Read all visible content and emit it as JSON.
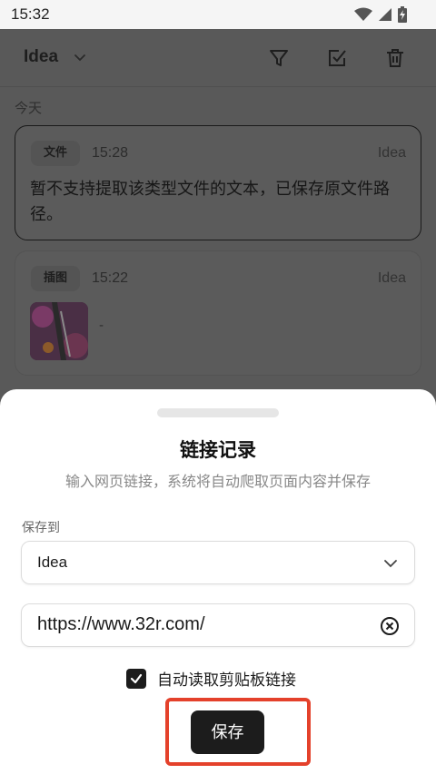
{
  "status_bar": {
    "time": "15:32",
    "icons": [
      "wifi-icon",
      "signal-icon",
      "battery-charging-icon"
    ]
  },
  "app_bar": {
    "title": "Idea",
    "actions": [
      "filter-icon",
      "select-check-icon",
      "delete-icon"
    ]
  },
  "section": {
    "label": "今天"
  },
  "cards": [
    {
      "tag": "文件",
      "time": "15:28",
      "source": "Idea",
      "body": "暂不支持提取该类型文件的文本，已保存原文件路径。"
    },
    {
      "tag": "插图",
      "time": "15:22",
      "source": "Idea",
      "body": "-"
    }
  ],
  "sheet": {
    "title": "链接记录",
    "subtitle": "输入网页链接，系统将自动爬取页面内容并保存",
    "save_to_label": "保存到",
    "save_to_value": "Idea",
    "url_value": "https://www.32r.com/",
    "auto_read_label": "自动读取剪贴板链接",
    "auto_read_checked": true,
    "save_button": "保存"
  },
  "colors": {
    "highlight": "#e4412b",
    "primary_button": "#1c1c1c"
  }
}
